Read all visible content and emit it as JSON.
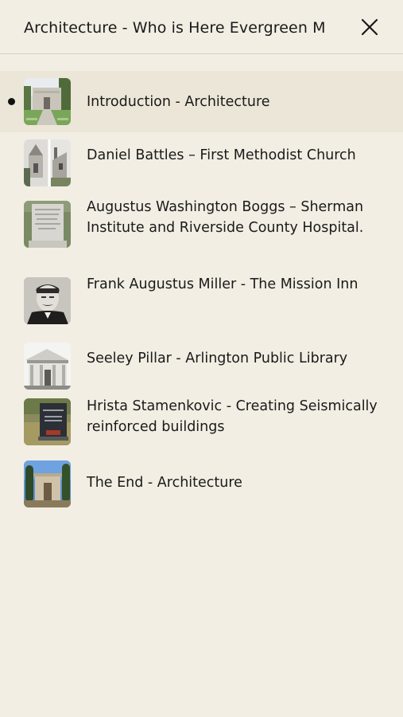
{
  "header": {
    "title": "Architecture - Who is Here Evergreen M",
    "close_icon": "close-icon"
  },
  "stops": [
    {
      "label": "Introduction - Architecture",
      "active": true,
      "thumb": "mausoleum-photo"
    },
    {
      "label": "Daniel Battles – First Methodist Church",
      "active": false,
      "thumb": "church-photo"
    },
    {
      "label": "Augustus Washington Boggs – Sherman Institute and Riverside County Hospital.",
      "active": false,
      "thumb": "grave-marker-photo"
    },
    {
      "label": "Frank Augustus Miller - The Mission Inn",
      "active": false,
      "thumb": "portrait-photo"
    },
    {
      "label": "Seeley Pillar - Arlington Public Library",
      "active": false,
      "thumb": "library-photo"
    },
    {
      "label": "Hrista Stamenkovic - Creating Seismically reinforced buildings",
      "active": false,
      "thumb": "headstone-photo"
    },
    {
      "label": "The End - Architecture",
      "active": false,
      "thumb": "mausoleum-trees-photo"
    }
  ]
}
